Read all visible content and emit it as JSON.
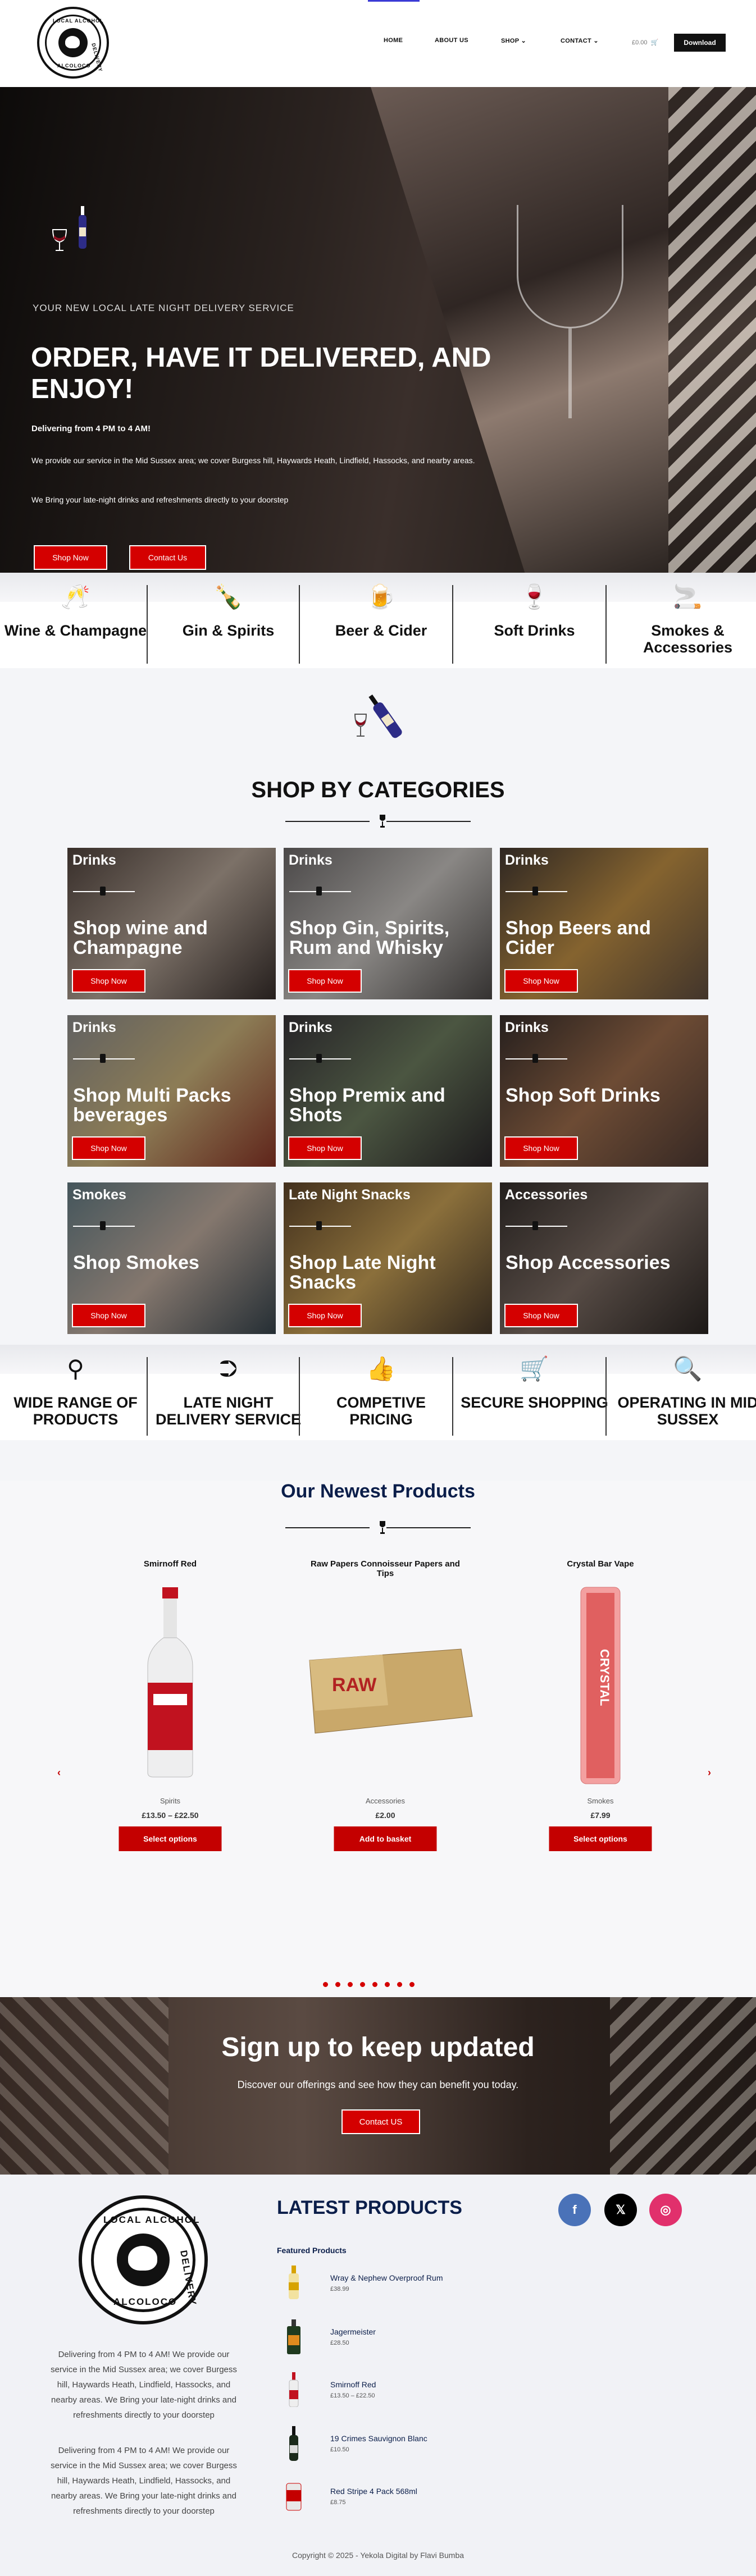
{
  "header": {
    "logo_text_top": "LOCAL ALCOHOL",
    "logo_text_right": "DELIVERY",
    "logo_text_bottom": "ALCOLOCO",
    "nav": [
      "HOME",
      "ABOUT US",
      "SHOP",
      "CONTACT"
    ],
    "cart_total": "£0.00",
    "download_label": "Download"
  },
  "hero": {
    "subtitle": "YOUR NEW LOCAL LATE NIGHT DELIVERY SERVICE",
    "title": "ORDER, HAVE IT DELIVERED, AND ENJOY!",
    "hours": "Delivering from 4 PM to 4 AM!",
    "area": "We provide our service in the Mid Sussex area; we cover Burgess hill, Haywards Heath, Lindfield, Hassocks, and nearby areas.",
    "promise": "We Bring your late-night drinks and refreshments directly to your doorstep",
    "shop_now": "Shop Now",
    "contact_us": "Contact Us"
  },
  "category_strip": [
    {
      "icon": "wine-glasses-icon",
      "label": "Wine & Champagne"
    },
    {
      "icon": "bottle-icon",
      "label": "Gin & Spirits"
    },
    {
      "icon": "beer-mug-icon",
      "label": "Beer & Cider"
    },
    {
      "icon": "cocktail-glass-icon",
      "label": "Soft Drinks"
    },
    {
      "icon": "cigarette-icon",
      "label": "Smokes & Accessories"
    }
  ],
  "shop_by_categories": {
    "heading": "SHOP BY CATEGORIES",
    "tiles": [
      {
        "tag": "Drinks",
        "title": "Shop wine and Champagne",
        "button": "Shop Now"
      },
      {
        "tag": "Drinks",
        "title": "Shop Gin, Spirits, Rum and Whisky",
        "button": "Shop Now"
      },
      {
        "tag": "Drinks",
        "title": "Shop Beers and Cider",
        "button": "Shop Now"
      },
      {
        "tag": "Drinks",
        "title": "Shop Multi Packs beverages",
        "button": "Shop Now"
      },
      {
        "tag": "Drinks",
        "title": "Shop Premix and Shots",
        "button": "Shop Now"
      },
      {
        "tag": "Drinks",
        "title": "Shop Soft Drinks",
        "button": "Shop Now"
      },
      {
        "tag": "Smokes",
        "title": "Shop Smokes",
        "button": "Shop Now"
      },
      {
        "tag": "Late Night Snacks",
        "title": "Shop Late Night Snacks",
        "button": "Shop Now"
      },
      {
        "tag": "Accessories",
        "title": "Shop Accessories",
        "button": "Shop Now"
      }
    ]
  },
  "features": [
    {
      "icon": "binoculars-icon",
      "label": "WIDE RANGE OF PRODUCTS"
    },
    {
      "icon": "arrow-box-icon",
      "label": "LATE NIGHT DELIVERY SERVICE"
    },
    {
      "icon": "thumbs-up-icon",
      "label": "COMPETIVE PRICING"
    },
    {
      "icon": "cart-icon",
      "label": "SECURE SHOPPING"
    },
    {
      "icon": "search-icon",
      "label": "OPERATING IN MID SUSSEX"
    }
  ],
  "newest": {
    "heading": "Our Newest Products",
    "products": [
      {
        "name": "Smirnoff Red",
        "category": "Spirits",
        "price": "£13.50 – £22.50",
        "button": "Select options"
      },
      {
        "name": "Raw Papers Connoisseur Papers and Tips",
        "category": "Accessories",
        "price": "£2.00",
        "button": "Add to basket"
      },
      {
        "name": "Crystal Bar Vape",
        "category": "Smokes",
        "price": "£7.99",
        "button": "Select options"
      }
    ],
    "prev": "‹",
    "next": "›",
    "raw_label": "RAW",
    "vape_label": "CRYSTAL"
  },
  "signup": {
    "heading": "Sign up to keep updated",
    "text": "Discover our offerings and see how they can benefit you today.",
    "button": "Contact US"
  },
  "footer": {
    "para1": "Delivering from 4 PM to 4 AM! We provide our service in the Mid Sussex area; we cover Burgess hill, Haywards Heath, Lindfield, Hassocks, and nearby areas. We Bring your late-night drinks and refreshments directly to your doorstep",
    "para2": "Delivering from 4 PM to 4 AM! We provide our service in the Mid Sussex area; we cover Burgess hill, Haywards Heath, Lindfield, Hassocks, and nearby areas. We Bring your late-night drinks and refreshments directly to your doorstep",
    "latest_heading": "LATEST PRODUCTS",
    "featured_label": "Featured Products",
    "latest": [
      {
        "name": "Wray & Nephew Overproof Rum",
        "price": "£38.99"
      },
      {
        "name": "Jagermeister",
        "price": "£28.50"
      },
      {
        "name": "Smirnoff Red",
        "price": "£13.50 – £22.50"
      },
      {
        "name": "19 Crimes Sauvignon Blanc",
        "price": "£10.50"
      },
      {
        "name": "Red Stripe 4 Pack 568ml",
        "price": "£8.75"
      }
    ],
    "social": {
      "facebook": "f",
      "x": "𝕏",
      "instagram": "◎"
    },
    "copyright": "Copyright © 2025 - Yekola Digital by Flavi Bumba"
  },
  "colors": {
    "accent": "#d40000",
    "navy": "#0b1e4a",
    "facebook": "#3b5998",
    "x": "#000000",
    "instagram": "#e1306c"
  }
}
